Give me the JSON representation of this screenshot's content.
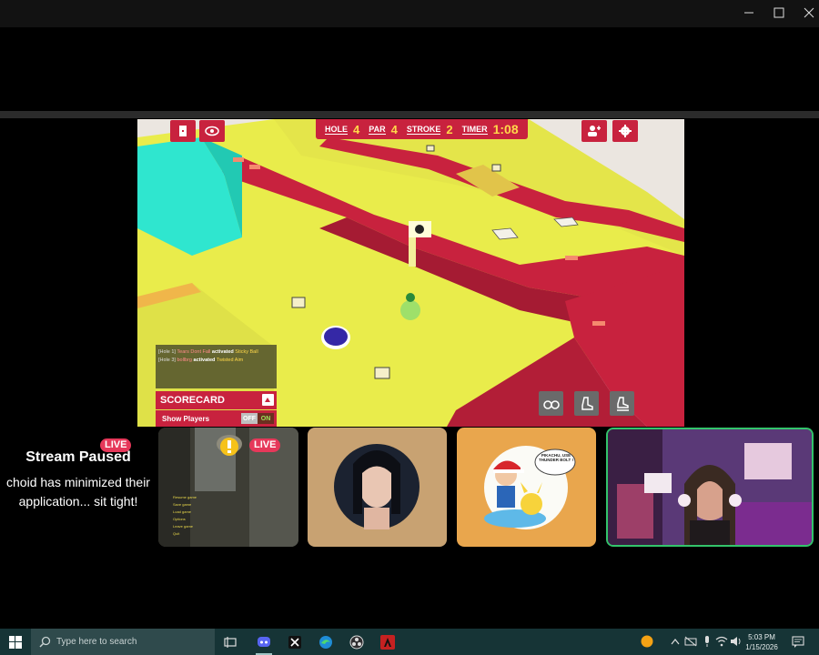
{
  "window": {
    "controls": {
      "minimize_icon": "minimize-icon",
      "maximize_icon": "maximize-icon",
      "close_icon": "close-icon"
    }
  },
  "game": {
    "hud": {
      "hole_label": "HOLE",
      "hole_value": "4",
      "par_label": "PAR",
      "par_value": "4",
      "stroke_label": "STROKE",
      "stroke_value": "2",
      "timer_label": "TIMER",
      "timer_value": "1:08"
    },
    "flag_number": "4",
    "chat": [
      {
        "prefix": "[Hole 1] ",
        "name": "Tears Dont Fall",
        "verb": " activated ",
        "power": "Sticky Ball"
      },
      {
        "prefix": "[Hole 3] ",
        "name": "bollbrg",
        "verb": " activated ",
        "power": "Twisted Aim"
      }
    ],
    "scorecard_label": "SCORECARD",
    "show_players_label": "Show Players",
    "toggle_off": "OFF",
    "toggle_on": "ON",
    "colors": {
      "accent": "#c8223e",
      "floor": "#e8ec4a",
      "wall": "#c8223e",
      "timer": "#ffd84a"
    }
  },
  "stream": {
    "live_badge": "LIVE",
    "paused_title": "Stream Paused",
    "paused_message": "choid has minimized their application... sit tight!",
    "tile_live_badge": "LIVE",
    "tile_menu": [
      "Resume game",
      "Save game",
      "Load game",
      "Options",
      "Leave game",
      "Quit"
    ],
    "pika_bubble": "PIKACHU, USE THUNDER BOLT !"
  },
  "taskbar": {
    "search_placeholder": "Type here to search",
    "time": "5:03 PM",
    "date": "1/15/2026"
  }
}
